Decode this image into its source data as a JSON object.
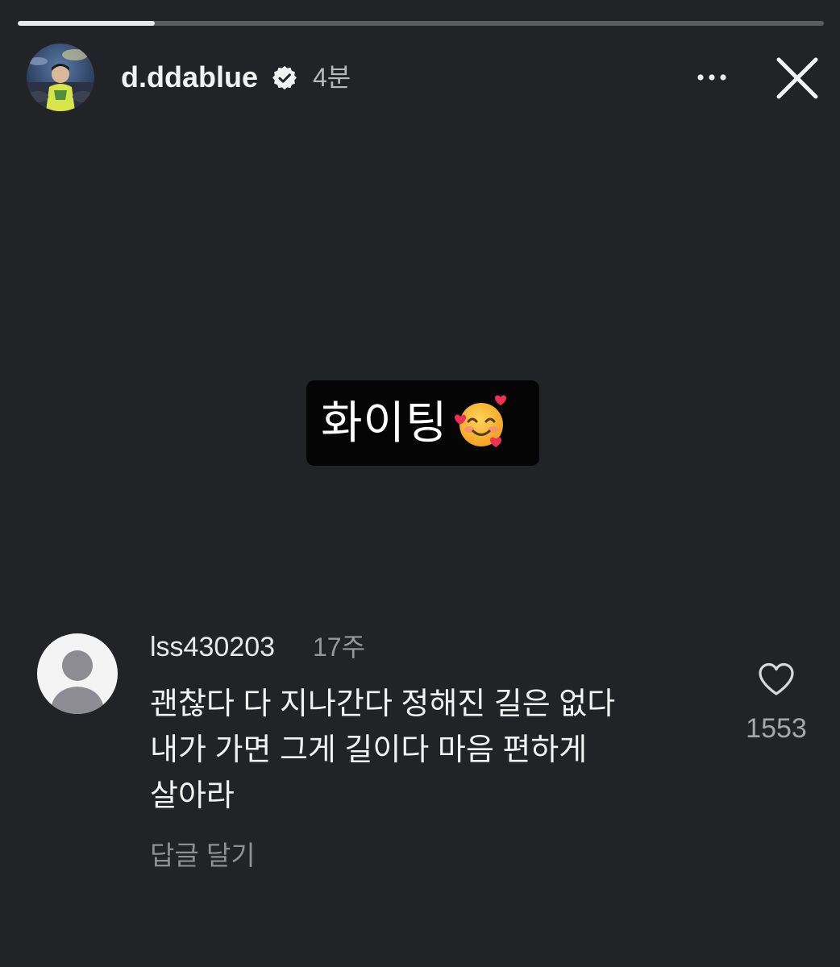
{
  "story": {
    "progress": 0.17,
    "account": {
      "username": "d.ddablue",
      "verified": true,
      "time": "4분",
      "avatar_icon": "profile-photo"
    },
    "controls": {
      "more_icon": "more-horizontal-icon",
      "close_icon": "close-icon"
    },
    "sticker": {
      "text": "화이팅",
      "emoji": "smiling-face-with-hearts"
    },
    "comment": {
      "username": "lss430203",
      "time": "17주",
      "lines": [
        "괜찮다 다 지나간다 정해진 길은 없다",
        "내가 가면 그게 길이다 마음 편하게",
        "살아라"
      ],
      "reply_label": "답글 달기",
      "like_count": "1553",
      "avatar_icon": "default-avatar"
    }
  },
  "colors": {
    "background": "#222327",
    "sticker_bg": "#050505",
    "progress_fill": "#e8e8ea",
    "progress_track": "#5b5c60"
  }
}
